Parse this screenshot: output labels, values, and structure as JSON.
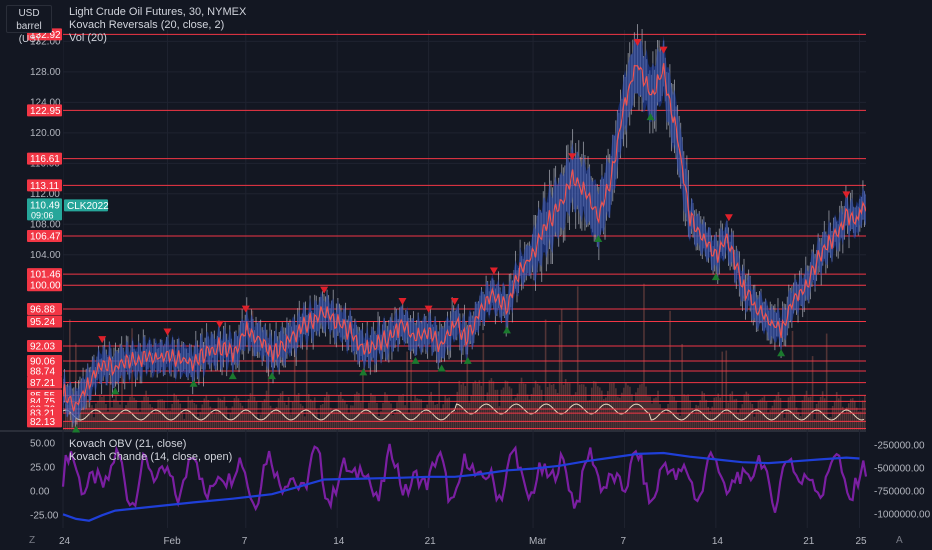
{
  "header": {
    "currency": "USD",
    "unit": "barrel (US)",
    "title": "Light Crude Oil Futures, 30, NYMEX",
    "indicator_1": "Kovach Reversals (20, close, 2)",
    "indicator_2": "Vol (20)",
    "pane_indicator_1": "Kovach OBV (21, close)",
    "pane_indicator_2": "Kovach Chande (14, close, open)"
  },
  "footer": {
    "zoom_button": "Z",
    "auto_button": "A"
  },
  "colors": {
    "background": "#131722",
    "grid": "#1f2330",
    "hline": "#f23645",
    "price_line": "#ef5350",
    "band": "#1e40af",
    "candle": "#b2b5be",
    "up_arrow": "#1b7a2e",
    "down_arrow": "#e0202a",
    "obv": "#1f3fd8",
    "chande": "#7b1fa2",
    "volume": "#5d3a3a",
    "vol_ma": "#e8d8c0",
    "current_tag": "#26a69a"
  },
  "chart_data": [
    {
      "type": "line",
      "title": "Light Crude Oil Futures, 30, NYMEX",
      "symbol": "CLK2022",
      "last_price": "110.49",
      "countdown": "09:06",
      "xlabel": "",
      "ylabel": "",
      "ylim": [
        81.0,
        133.5
      ],
      "y_ticks": [
        "132.00",
        "128.00",
        "124.00",
        "120.00",
        "116.00",
        "112.00",
        "108.00",
        "104.00",
        "100.00"
      ],
      "x_ticks": [
        "24",
        "Feb",
        "7",
        "14",
        "21",
        "Mar",
        "7",
        "14",
        "21",
        "25"
      ],
      "x_tick_days": [
        0,
        8,
        14,
        21,
        28,
        36,
        43,
        50,
        57,
        61
      ],
      "x_range_days": [
        0,
        61.5
      ],
      "grid": true,
      "horizontal_levels": [
        132.92,
        122.95,
        116.61,
        113.11,
        106.47,
        101.46,
        100.0,
        96.88,
        95.24,
        92.03,
        90.06,
        88.74,
        87.21,
        85.55,
        84.75,
        83.76,
        83.21,
        82.13,
        81.2
      ],
      "level_labels": [
        "132.92",
        "122.95",
        "116.61",
        "113.11",
        "106.47",
        "101.46",
        "100.00",
        "96.88",
        "95.24",
        "92.03",
        "90.06",
        "88.74",
        "87.21",
        "85.55",
        "84.75",
        "83.76",
        "83.21",
        "82.13"
      ],
      "price_path": {
        "x": [
          0,
          1,
          2,
          3,
          4,
          5,
          6,
          8,
          10,
          12,
          13,
          14,
          15,
          16,
          17,
          18,
          20,
          21,
          22,
          23,
          25,
          26,
          27,
          28,
          29,
          30,
          31,
          32,
          33,
          34,
          35,
          36,
          37,
          38,
          39,
          40,
          41,
          42,
          43,
          44,
          45,
          46,
          47,
          48,
          49,
          50,
          51,
          52,
          53,
          54,
          55,
          56,
          57,
          58,
          59,
          60,
          61
        ],
        "y": [
          86,
          84,
          87,
          90,
          89,
          90,
          90.5,
          91,
          90,
          92,
          91,
          94,
          93,
          91,
          92,
          94,
          96.5,
          95,
          94,
          91.5,
          93,
          95,
          93,
          94,
          92,
          95,
          93,
          97,
          99,
          97,
          102,
          104,
          108,
          110,
          114,
          112,
          109,
          114,
          124,
          129,
          125,
          128,
          120,
          109,
          106,
          104,
          106,
          100,
          97,
          95.5,
          94,
          98,
          100,
          104,
          106,
          109,
          108,
          110.5,
          113,
          115,
          110.5
        ],
        "note": "price path by day index"
      },
      "series": [
        {
          "name": "Volume",
          "type": "bar"
        },
        {
          "name": "Vol MA",
          "type": "line"
        }
      ]
    },
    {
      "type": "line",
      "ylim_left": [
        -38,
        62
      ],
      "y_ticks_left": [
        "50.00",
        "25.00",
        "0.00",
        "-25.00"
      ],
      "y_ticks_right": [
        "-250000.00",
        "-500000.00",
        "-750000.00",
        "-1000000.00"
      ],
      "series": [
        {
          "name": "Kovach OBV (21, close)",
          "axis": "right",
          "x": [
            0,
            1,
            2,
            3,
            4,
            6,
            8,
            10,
            13,
            16,
            18,
            20,
            23,
            26,
            28,
            30,
            32,
            34,
            36,
            38,
            40,
            42,
            44,
            46,
            48,
            50,
            52,
            54,
            56,
            58,
            60,
            61
          ],
          "y": [
            -1000000,
            -1050000,
            -1070000,
            -1010000,
            -960000,
            -930000,
            -900000,
            -870000,
            -830000,
            -780000,
            -700000,
            -620000,
            -610000,
            -600000,
            -590000,
            -590000,
            -560000,
            -520000,
            -500000,
            -470000,
            -420000,
            -380000,
            -340000,
            -330000,
            -370000,
            -400000,
            -430000,
            -440000,
            -420000,
            -400000,
            -380000,
            -390000
          ]
        },
        {
          "name": "Kovach Chande (14, close, open)",
          "axis": "left",
          "values_range": [
            -25,
            50
          ],
          "note": "oscillating"
        }
      ]
    }
  ]
}
